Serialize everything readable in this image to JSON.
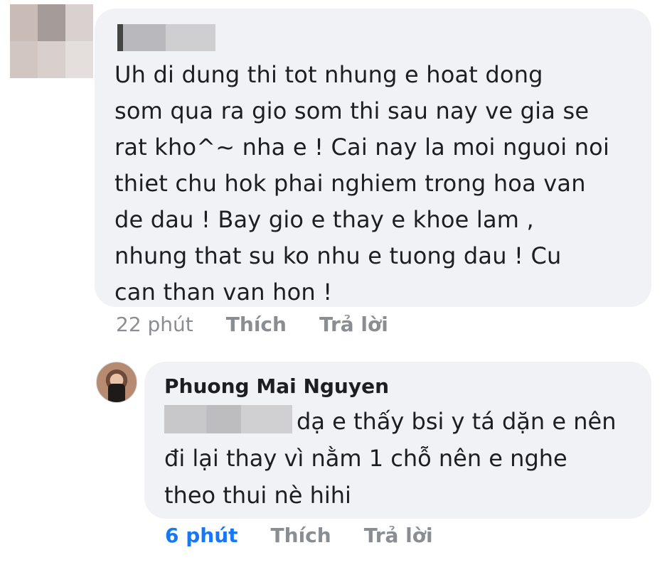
{
  "comment1": {
    "text": "Uh di dung thi tot nhung e hoat dong\nsom qua ra gio som thi sau nay ve gia se\nrat kho^~ nha e ! Cai nay la moi nguoi noi\nthiet chu hok phai nghiem trong hoa van\nde dau ! Bay gio e thay e khoe lam ,\nnhung that su ko nhu e tuong dau ! Cu\ncan than van hon !",
    "time": "22 phút",
    "like": "Thích",
    "reply": "Trả lời"
  },
  "comment2": {
    "author": "Phuong Mai Nguyen",
    "text_line1": "dạ e thấy bsi y tá dặn e nên",
    "text_line2": "đi lại thay vì nằm 1 chỗ nên e nghe",
    "text_line3": "theo thui nè hihi",
    "time": "6 phút",
    "like": "Thích",
    "reply": "Trả lời"
  },
  "colors": {
    "bubble": "#f0f2f5",
    "text": "#1c1e21",
    "meta": "#8a8d91",
    "link": "#1877f2"
  }
}
